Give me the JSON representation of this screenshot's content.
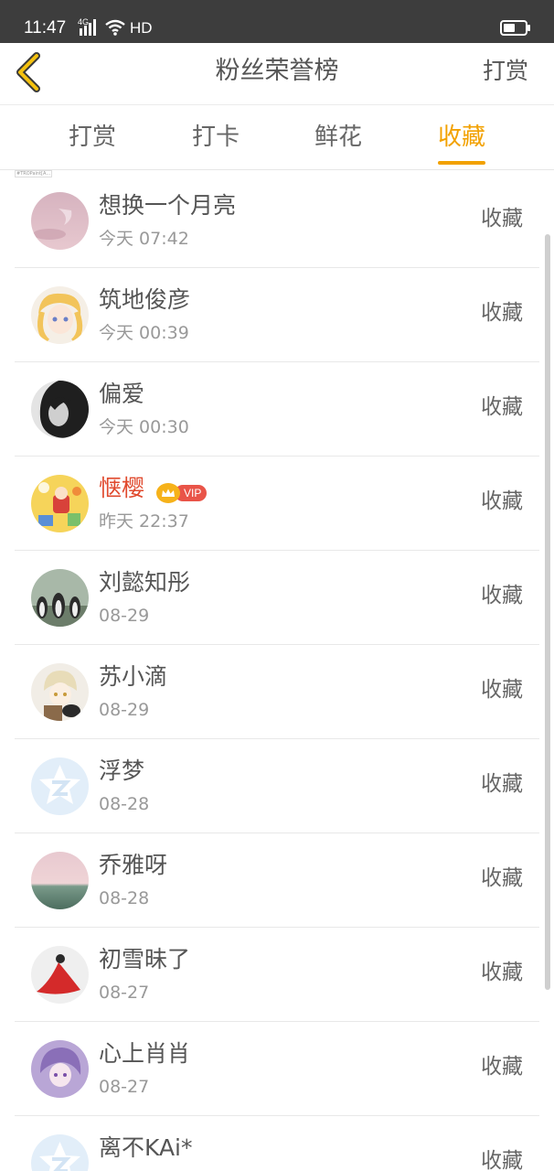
{
  "status_bar": {
    "time": "11:47",
    "network": "4G",
    "hd": "HD"
  },
  "header": {
    "title": "粉丝荣誉榜",
    "right_action": "打赏"
  },
  "tabs": [
    {
      "label": "打赏",
      "active": false
    },
    {
      "label": "打卡",
      "active": false
    },
    {
      "label": "鲜花",
      "active": false
    },
    {
      "label": "收藏",
      "active": true
    }
  ],
  "tiny_label": "#TROPaint[A…",
  "vip_label": "VIP",
  "accent_color": "#f2a100",
  "fans": [
    {
      "name": "想换一个月亮",
      "time": "今天 07:42",
      "action": "收藏",
      "vip": false,
      "avatar": "pink-sky-avatar"
    },
    {
      "name": "筑地俊彦",
      "time": "今天 00:39",
      "action": "收藏",
      "vip": false,
      "avatar": "anime-girl-avatar"
    },
    {
      "name": "偏爱",
      "time": "今天 00:30",
      "action": "收藏",
      "vip": false,
      "avatar": "bw-portrait-avatar"
    },
    {
      "name": "惬樱",
      "time": "昨天 22:37",
      "action": "收藏",
      "vip": true,
      "avatar": "cartoon-avatar"
    },
    {
      "name": "刘懿知彤",
      "time": "08-29",
      "action": "收藏",
      "vip": false,
      "avatar": "penguins-avatar"
    },
    {
      "name": "苏小滴",
      "time": "08-29",
      "action": "收藏",
      "vip": false,
      "avatar": "anime-cat-avatar"
    },
    {
      "name": "浮梦",
      "time": "08-28",
      "action": "收藏",
      "vip": false,
      "avatar": "default-avatar"
    },
    {
      "name": "乔雅呀",
      "time": "08-28",
      "action": "收藏",
      "vip": false,
      "avatar": "sunset-avatar"
    },
    {
      "name": "初雪昧了",
      "time": "08-27",
      "action": "收藏",
      "vip": false,
      "avatar": "red-dress-avatar"
    },
    {
      "name": "心上肖肖",
      "time": "08-27",
      "action": "收藏",
      "vip": false,
      "avatar": "purple-anime-avatar"
    },
    {
      "name": "离不KAi*",
      "time": "",
      "action": "收藏",
      "vip": false,
      "avatar": "default-avatar"
    }
  ]
}
